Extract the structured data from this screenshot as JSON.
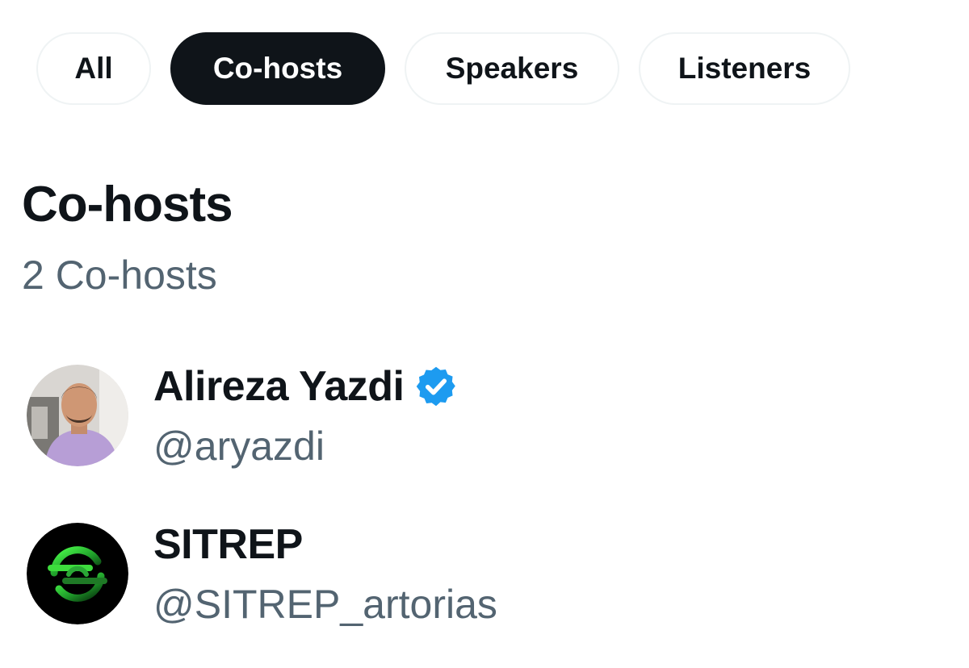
{
  "tabs": [
    {
      "label": "All",
      "active": false
    },
    {
      "label": "Co-hosts",
      "active": true
    },
    {
      "label": "Speakers",
      "active": false
    },
    {
      "label": "Listeners",
      "active": false
    }
  ],
  "section": {
    "title": "Co-hosts",
    "count": "2 Co-hosts"
  },
  "users": [
    {
      "name": "Alireza Yazdi",
      "handle": "@aryazdi",
      "verified": true,
      "avatar_icon": "profile-photo"
    },
    {
      "name": "SITREP",
      "handle": "@SITREP_artorias",
      "verified": false,
      "avatar_icon": "sitrep-logo"
    }
  ],
  "colors": {
    "text_primary": "#0f1419",
    "text_secondary": "#536471",
    "active_tab_bg": "#0f1419",
    "tab_border": "#eff3f4",
    "verified_badge": "#1d9bf0",
    "sitrep_green": "#3ddc3d"
  }
}
